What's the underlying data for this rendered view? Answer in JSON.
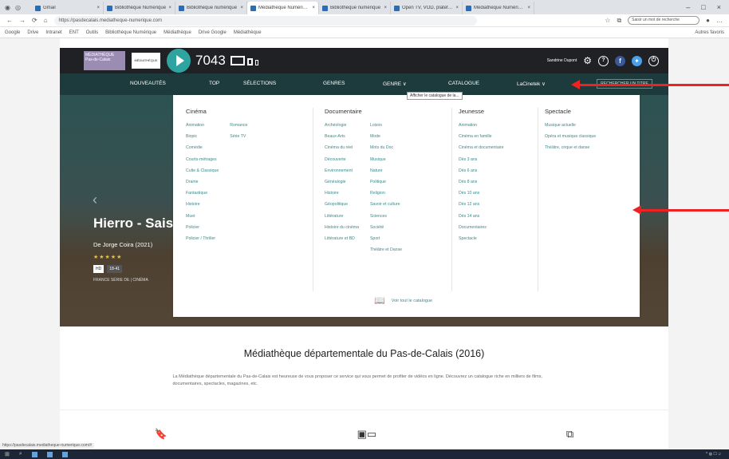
{
  "browser": {
    "tabs": [
      {
        "label": "Gmail",
        "active": false
      },
      {
        "label": "Bibliothèque Numérique",
        "active": false
      },
      {
        "label": "Bibliothèque numérique",
        "active": false
      },
      {
        "label": "Médiathèque Numérique",
        "active": true
      },
      {
        "label": "Bibliothèque numérique",
        "active": false
      },
      {
        "label": "Open TV, VOD, plateforme",
        "active": false
      },
      {
        "label": "Médiathèque Numérique",
        "active": false
      }
    ],
    "url": "https://pasdecalais.mediatheque-numerique.com",
    "search_placeholder": "Saisir un mot de recherche",
    "bookmarks": [
      "Google",
      "Drive",
      "Intranet",
      "ENT",
      "Outils",
      "Bibliothèque Numérique",
      "Médiathèque",
      "Drive Google",
      "Médiathèque"
    ],
    "bookmarks_right": "Autres favoris",
    "status_url": "https://pasdecalais.mediatheque-numerique.com/#"
  },
  "site": {
    "logo_text": "MÉDIATHÈQUE",
    "logo_sub": "Pas-de-Calais",
    "logo2_text": "MÉDIATHÈQUE NUMÉRIQUE",
    "count": "7043",
    "user_name": "Sandrine Dupont",
    "nav": [
      "NOUVEAUTÉS",
      "TOP",
      "SÉLECTIONS",
      "GENRES",
      "GENRE ∨",
      "CATALOGUE",
      "LaCinetek ∨"
    ],
    "nav_button": "RECHERCHER UN TITRE",
    "tooltip": "Afficher le catalogue de la..."
  },
  "hero": {
    "title": "Hierro - Sais",
    "subtitle": "De Jorge Coira (2021)",
    "stars": "★★★★★",
    "badges": [
      "HD",
      "18-41"
    ],
    "tags": "FRANCE  SÉRIE DE  |  CINÉMA"
  },
  "menu": {
    "columns": [
      {
        "heading": "Cinéma",
        "lists": [
          [
            "Animation",
            "Biopic",
            "Comédie",
            "Courts-métrages",
            "Culte & Classique",
            "Drame",
            "Fantastique",
            "Histoire",
            "Muet",
            "Policier",
            "Policier / Thriller"
          ],
          [
            "Romance",
            "Série TV"
          ]
        ]
      },
      {
        "heading": "Documentaire",
        "lists": [
          [
            "Archéologie",
            "Beaux-Arts",
            "Cinéma du réel",
            "Découverte",
            "Environnement",
            "Généalogie",
            "Histoire",
            "Géopolitique",
            "Littérature",
            "Histoire du cinéma",
            "Littérature et BD"
          ],
          [
            "Loisirs",
            "Mode",
            "Mots du Doc",
            "Musique",
            "Nature",
            "Politique",
            "Religion",
            "Savoir et culture",
            "Sciences",
            "Société",
            "Sport",
            "Théâtre et Danse"
          ]
        ]
      },
      {
        "heading": "Jeunesse",
        "lists": [
          [
            "Animation",
            "Cinéma en famille",
            "Cinéma et documentaire",
            "Dès 3 ans",
            "Dès 6 ans",
            "Dès 8 ans",
            "Dès 10 ans",
            "Dès 12 ans",
            "Dès 14 ans",
            "Documentaires",
            "Spectacle"
          ]
        ]
      },
      {
        "heading": "Spectacle",
        "lists": [
          [
            "Musique actuelle",
            "Opéra et musique classique",
            "Théâtre, cirque et danse"
          ]
        ]
      }
    ],
    "catalog_link": "Voir tout le catalogue"
  },
  "about": {
    "title": "Médiathèque départementale du Pas-de-Calais (2016)",
    "text": "La Médiathèque départementale du Pas-de-Calais est heureuse de vous proposer ce service qui vous permet de profiter de vidéos en ligne. Découvrez un catalogue riche en milliers de films, documentaires, spectacles, magazines, etc."
  },
  "colors": {
    "accent": "#2fa3a0",
    "nav_bg": "#1d3a3c",
    "arrow": "#e22222"
  }
}
